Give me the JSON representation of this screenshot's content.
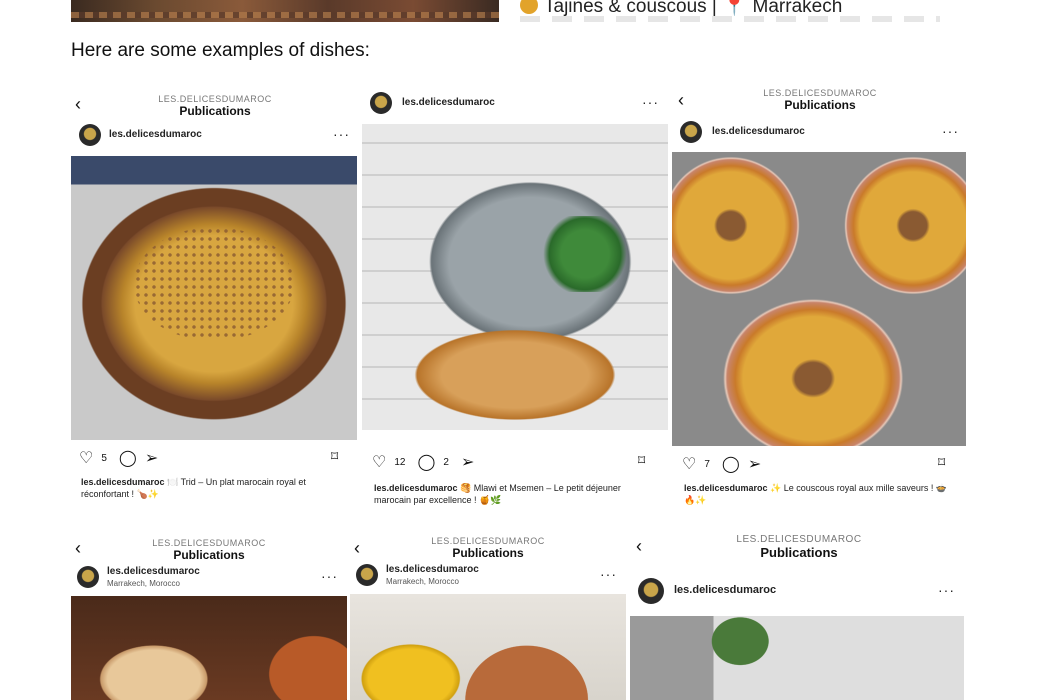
{
  "top": {
    "snippet_text": "Tajines & couscous |",
    "snippet_location": "Marrakech",
    "pin_icon": "pin-icon"
  },
  "intro": "Here are some examples of dishes:",
  "colors": {
    "text": "#111111",
    "pin": "#dd3333",
    "muted": "#777777"
  },
  "posts": [
    {
      "header_small": "LES.DELICESDUMAROC",
      "header_big": "Publications",
      "username": "les.delicesdumaroc",
      "location": "",
      "likes": "5",
      "comments": "",
      "caption_user": "les.delicesdumaroc",
      "caption": "🍽️ Trid – Un plat marocain royal et réconfortant ! 🍗✨"
    },
    {
      "header_small": "",
      "header_big": "",
      "username": "les.delicesdumaroc",
      "location": "",
      "likes": "12",
      "comments": "2",
      "caption_user": "les.delicesdumaroc",
      "caption": "🥞 Mlawi et Msemen – Le petit déjeuner marocain par excellence ! 🍯🌿"
    },
    {
      "header_small": "LES.DELICESDUMAROC",
      "header_big": "Publications",
      "username": "les.delicesdumaroc",
      "location": "",
      "likes": "7",
      "comments": "",
      "caption_user": "les.delicesdumaroc",
      "caption": "✨ Le couscous royal aux mille saveurs ! 🍲🔥✨"
    },
    {
      "header_small": "LES.DELICESDUMAROC",
      "header_big": "Publications",
      "username": "les.delicesdumaroc",
      "location": "Marrakech, Morocco"
    },
    {
      "header_small": "LES.DELICESDUMAROC",
      "header_big": "Publications",
      "username": "les.delicesdumaroc",
      "location": "Marrakech, Morocco"
    },
    {
      "header_small": "LES.DELICESDUMAROC",
      "header_big": "Publications",
      "username": "les.delicesdumaroc",
      "location": ""
    }
  ],
  "icons": {
    "back": "back-arrow-icon",
    "more": "more-options-icon",
    "like": "heart-icon",
    "comment": "comment-icon",
    "share": "send-icon",
    "save": "bookmark-icon"
  }
}
